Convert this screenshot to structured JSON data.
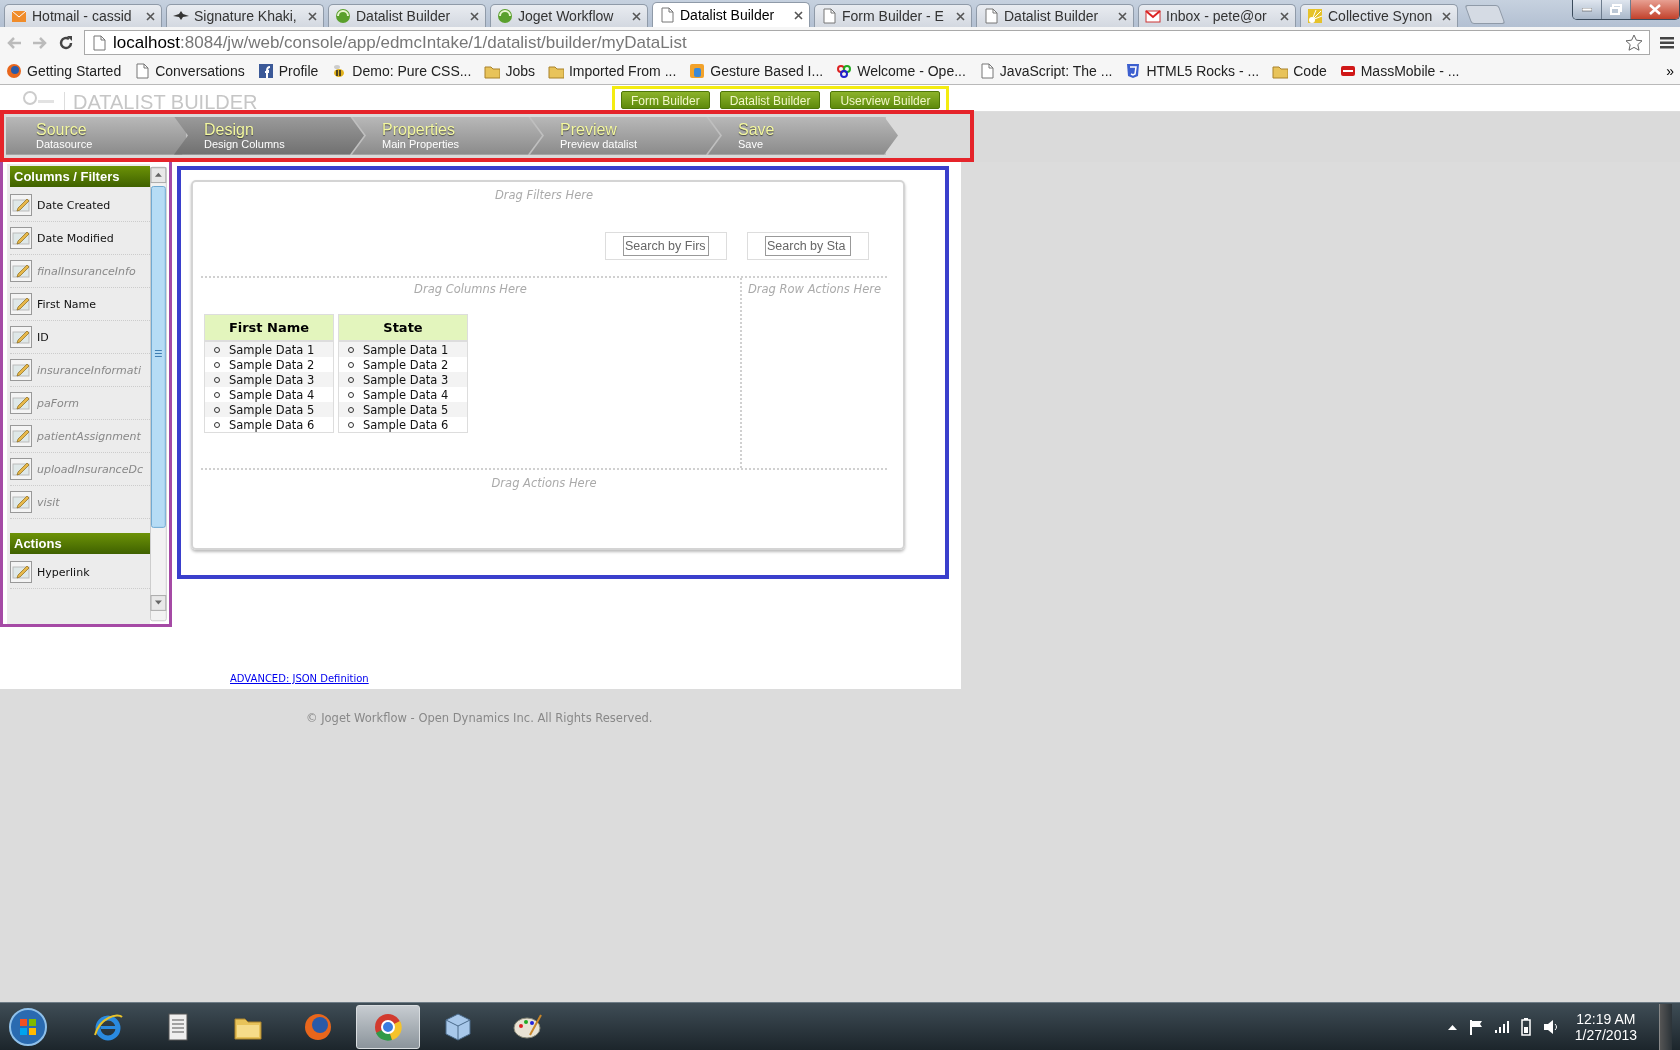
{
  "browser": {
    "tabs": [
      {
        "title": "Hotmail - cassid",
        "kind": "mail",
        "selected": false
      },
      {
        "title": "Signature Khaki,",
        "kind": "bird",
        "selected": false
      },
      {
        "title": "Datalist Builder",
        "kind": "site",
        "selected": false
      },
      {
        "title": "Joget Workflow",
        "kind": "site",
        "selected": false
      },
      {
        "title": "Datalist Builder",
        "kind": "page",
        "selected": true
      },
      {
        "title": "Form Builder - E",
        "kind": "page",
        "selected": false
      },
      {
        "title": "Datalist Builder",
        "kind": "page",
        "selected": false
      },
      {
        "title": "Inbox - pete@or",
        "kind": "gmail",
        "selected": false
      },
      {
        "title": "Collective Synon",
        "kind": "sun",
        "selected": false
      }
    ],
    "url_host": "localhost",
    "url_rest": ":8084/jw/web/console/app/edmcIntake/1/datalist/builder/myDataList",
    "bookmarks": [
      {
        "label": "Getting Started",
        "kind": "firefox"
      },
      {
        "label": "Conversations",
        "kind": "page"
      },
      {
        "label": "Profile",
        "kind": "facebook"
      },
      {
        "label": "Demo: Pure CSS...",
        "kind": "bee"
      },
      {
        "label": "Jobs",
        "kind": "folder"
      },
      {
        "label": "Imported From ...",
        "kind": "folder"
      },
      {
        "label": "Gesture Based I...",
        "kind": "gesture"
      },
      {
        "label": "Welcome - Ope...",
        "kind": "rings"
      },
      {
        "label": "JavaScript: The ...",
        "kind": "page"
      },
      {
        "label": "HTML5 Rocks - ...",
        "kind": "html5"
      },
      {
        "label": "Code",
        "kind": "folder"
      },
      {
        "label": "MassMobile - ...",
        "kind": "mass"
      }
    ],
    "bookmarks_more": "»"
  },
  "header": {
    "title": "DATALIST BUILDER",
    "buttons": [
      "Form Builder",
      "Datalist Builder",
      "Userview Builder"
    ]
  },
  "steps": [
    {
      "title": "Source",
      "subtitle": "Datasource",
      "selected": false
    },
    {
      "title": "Design",
      "subtitle": "Design Columns",
      "selected": true
    },
    {
      "title": "Properties",
      "subtitle": "Main Properties",
      "selected": false
    },
    {
      "title": "Preview",
      "subtitle": "Preview datalist",
      "selected": false
    },
    {
      "title": "Save",
      "subtitle": "Save",
      "selected": false
    }
  ],
  "palette": {
    "sections": [
      {
        "title": "Columns / Filters",
        "items": [
          {
            "label": "Date Created",
            "italic": false
          },
          {
            "label": "Date Modified",
            "italic": false
          },
          {
            "label": "finalInsuranceInfo",
            "italic": true
          },
          {
            "label": "First Name",
            "italic": false
          },
          {
            "label": "ID",
            "italic": false
          },
          {
            "label": "insuranceInformati",
            "italic": true
          },
          {
            "label": "paForm",
            "italic": true
          },
          {
            "label": "patientAssignment",
            "italic": true
          },
          {
            "label": "uploadInsuranceDc",
            "italic": true
          },
          {
            "label": "visit",
            "italic": true
          }
        ]
      },
      {
        "title": "Actions",
        "items": [
          {
            "label": "Hyperlink",
            "italic": false
          }
        ]
      }
    ]
  },
  "canvas": {
    "filters_hint": "Drag Filters Here",
    "filters": [
      {
        "placeholder": "Search by Firs"
      },
      {
        "placeholder": "Search by Sta"
      }
    ],
    "columns_hint": "Drag Columns Here",
    "row_actions_hint": "Drag Row Actions Here",
    "columns": [
      {
        "header": "First Name",
        "rows": [
          "Sample Data 1",
          "Sample Data 2",
          "Sample Data 3",
          "Sample Data 4",
          "Sample Data 5",
          "Sample Data 6"
        ]
      },
      {
        "header": "State",
        "rows": [
          "Sample Data 1",
          "Sample Data 2",
          "Sample Data 3",
          "Sample Data 4",
          "Sample Data 5",
          "Sample Data 6"
        ]
      }
    ],
    "actions_hint": "Drag Actions Here"
  },
  "json_link": "ADVANCED: JSON Definition",
  "footer": "© Joget Workflow - Open Dynamics Inc. All Rights Reserved.",
  "taskbar": {
    "apps": [
      {
        "selected": false
      },
      {
        "selected": false
      },
      {
        "selected": false
      },
      {
        "selected": false
      },
      {
        "selected": true
      },
      {
        "selected": false
      },
      {
        "selected": false
      }
    ],
    "time": "12:19 AM",
    "date": "1/27/2013"
  }
}
